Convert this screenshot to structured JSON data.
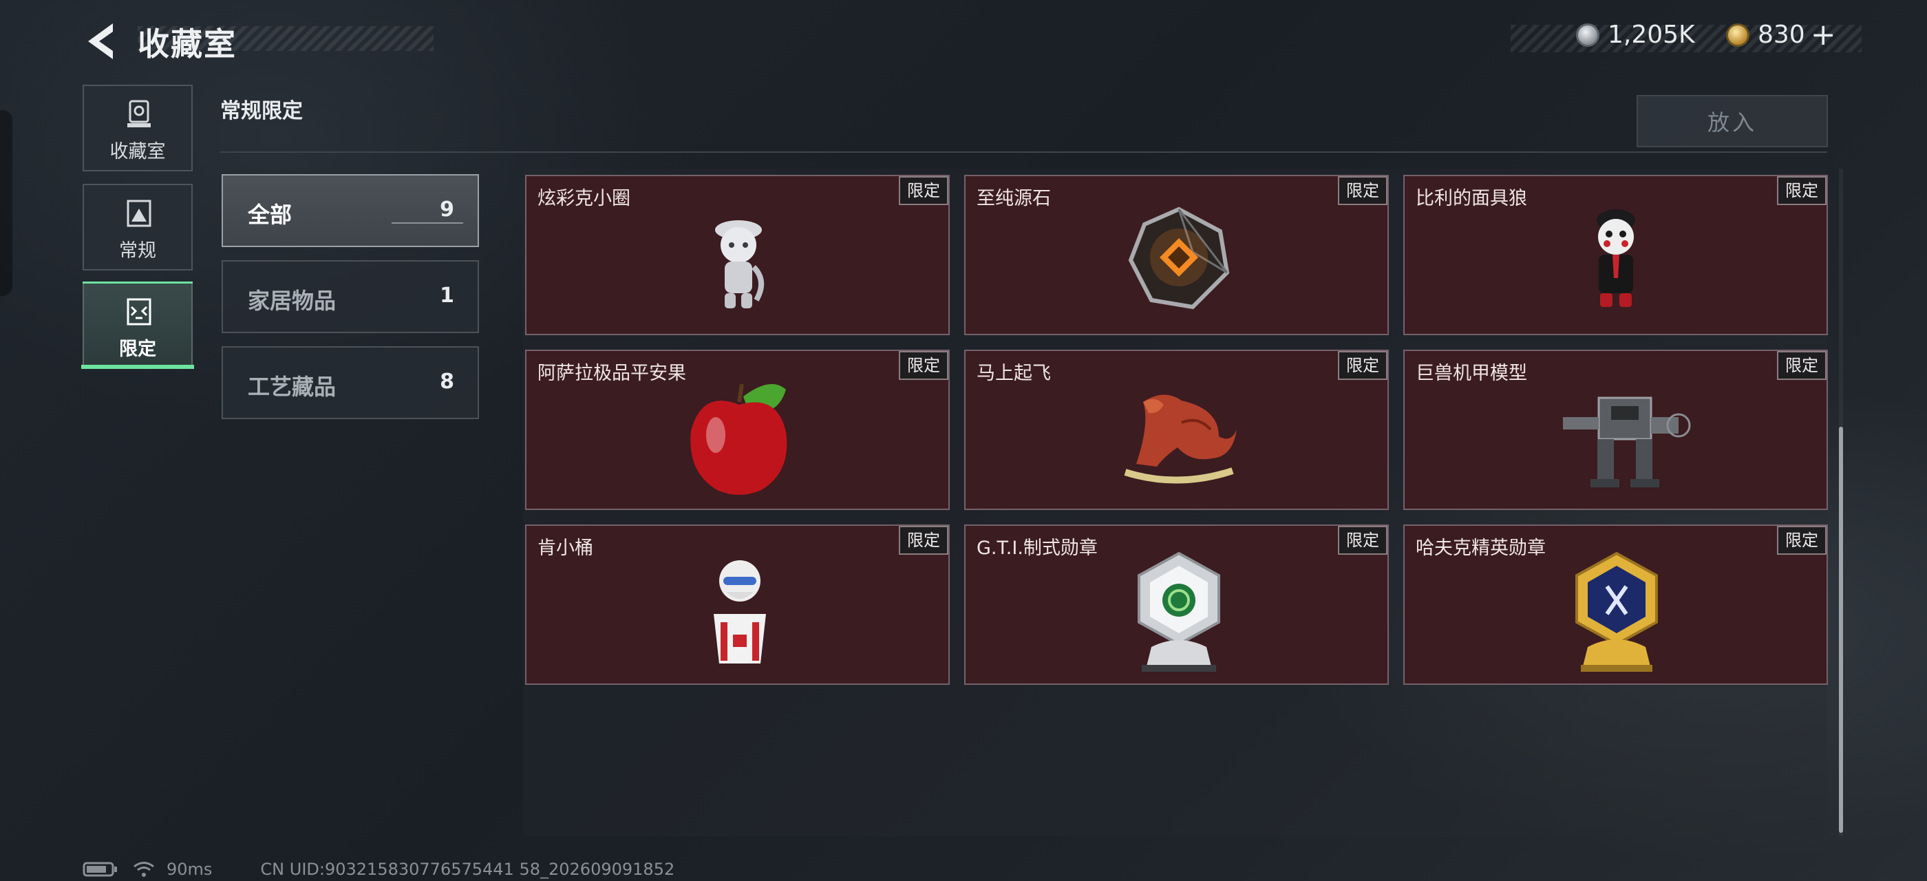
{
  "header": {
    "title": "收藏室",
    "back_icon": "chevron-left-icon",
    "currencies": [
      {
        "name": "silver-coin",
        "value": "1,205K",
        "color": "#b8bec4"
      },
      {
        "name": "gold-coin",
        "value": "830",
        "color": "#d7a84a"
      }
    ],
    "add_symbol": "+"
  },
  "sidebar": {
    "tabs": [
      {
        "label": "收藏室",
        "icon": "trophy-case-icon",
        "active": false
      },
      {
        "label": "常规",
        "icon": "image-frame-icon",
        "active": false
      },
      {
        "label": "限定",
        "icon": "limited-edition-icon",
        "active": true
      }
    ],
    "accent_color": "#6ee3a0"
  },
  "section": {
    "title": "常规限定",
    "put_in_label": "放入"
  },
  "categories": [
    {
      "name": "全部",
      "count": "9",
      "active": true
    },
    {
      "name": "家居物品",
      "count": "1",
      "active": false
    },
    {
      "name": "工艺藏品",
      "count": "8",
      "active": false
    }
  ],
  "items": [
    {
      "name": "炫彩克小圈",
      "badge": "限定",
      "icon": "figurine-icon"
    },
    {
      "name": "至纯源石",
      "badge": "限定",
      "icon": "crystal-stone-icon"
    },
    {
      "name": "比利的面具狼",
      "badge": "限定",
      "icon": "puppet-doll-icon"
    },
    {
      "name": "阿萨拉极品平安果",
      "badge": "限定",
      "icon": "apple-icon"
    },
    {
      "name": "马上起飞",
      "badge": "限定",
      "icon": "horse-sculpture-icon"
    },
    {
      "name": "巨兽机甲模型",
      "badge": "限定",
      "icon": "mech-model-icon"
    },
    {
      "name": "肯小桶",
      "badge": "限定",
      "icon": "chicken-bucket-figure-icon"
    },
    {
      "name": "G.T.I.制式勋章",
      "badge": "限定",
      "icon": "silver-medal-icon"
    },
    {
      "name": "哈夫克精英勋章",
      "badge": "限定",
      "icon": "gold-medal-icon"
    }
  ],
  "colors": {
    "card_bg": "#3b1c20",
    "card_border": "#75616a"
  },
  "status": {
    "battery_icon": "battery-icon",
    "wifi_icon": "wifi-icon",
    "ping": "90ms",
    "uid": "CN UID:903215830776575441 58_202609091852"
  }
}
